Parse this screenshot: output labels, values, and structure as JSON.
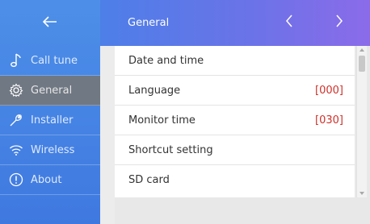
{
  "header": {
    "title": "General",
    "back_icon": "back-arrow-icon",
    "prev_icon": "chevron-left-icon",
    "next_icon": "chevron-right-icon"
  },
  "sidebar": {
    "items": [
      {
        "label": "Call tune",
        "icon": "music-note-icon",
        "active": false
      },
      {
        "label": "General",
        "icon": "gear-icon",
        "active": true
      },
      {
        "label": "Installer",
        "icon": "wrench-icon",
        "active": false
      },
      {
        "label": "Wireless",
        "icon": "wifi-icon",
        "active": false
      },
      {
        "label": "About",
        "icon": "info-icon",
        "active": false
      }
    ]
  },
  "settings": {
    "rows": [
      {
        "label": "Date and time",
        "value": ""
      },
      {
        "label": "Language",
        "value": "[000]"
      },
      {
        "label": "Monitor time",
        "value": "[030]"
      },
      {
        "label": "Shortcut setting",
        "value": ""
      },
      {
        "label": "SD card",
        "value": ""
      }
    ]
  },
  "colors": {
    "accent": "#4d8fe8",
    "active_item": "#707883",
    "value_text": "#d0302a"
  }
}
